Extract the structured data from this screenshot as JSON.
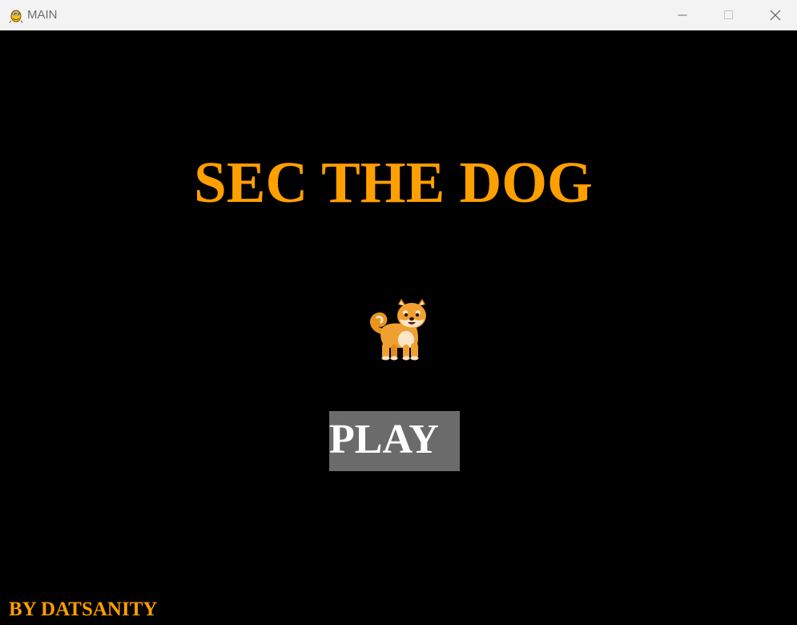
{
  "window": {
    "title": "MAIN",
    "app_icon": "pygame-snake-icon",
    "controls": {
      "minimize_icon": "minimize-icon",
      "maximize_icon": "maximize-icon",
      "close_icon": "close-icon"
    }
  },
  "game": {
    "title": "SEC THE DOG",
    "sprite_icon": "shiba-dog-icon",
    "play_label": "PLAY",
    "credit": "BY DATSANITY"
  },
  "colors": {
    "background": "#000000",
    "accent": "#ff9f00",
    "button_bg": "#6b6b6b",
    "button_text": "#ffffff",
    "titlebar_bg": "#f3f3f3"
  }
}
